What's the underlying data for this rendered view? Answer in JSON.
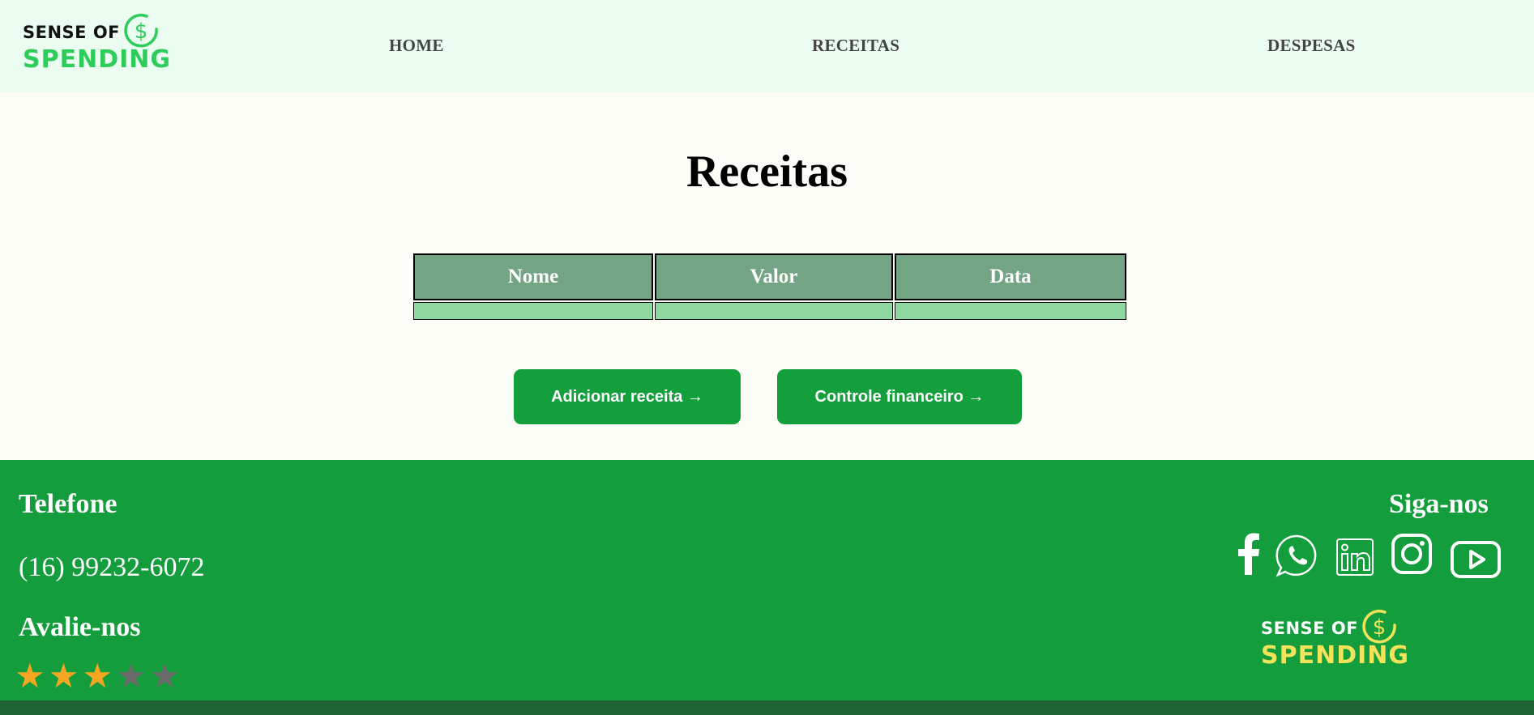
{
  "brand": {
    "line1": "SENSE OF",
    "line2": "SPENDING",
    "symbol": "$"
  },
  "nav": {
    "home": "HOME",
    "receitas": "RECEITAS",
    "despesas": "DESPESAS"
  },
  "main": {
    "title": "Receitas",
    "table": {
      "headers": [
        "Nome",
        "Valor",
        "Data"
      ],
      "rows": [
        [
          "",
          "",
          ""
        ]
      ]
    },
    "buttons": {
      "add": "Adicionar receita →",
      "control": "Controle financeiro →"
    }
  },
  "footer": {
    "phone_heading": "Telefone",
    "phone": "(16) 99232-6072",
    "rate_heading": "Avalie-nos",
    "rating": {
      "value": 3,
      "max": 5,
      "star_glyph": "★"
    },
    "follow_heading": "Siga-nos",
    "social_icons": [
      "facebook-icon",
      "whatsapp-icon",
      "linkedin-icon",
      "instagram-icon",
      "youtube-icon"
    ]
  },
  "colors": {
    "header_bg": "#eafdf0",
    "accent_green": "#13a03c",
    "logo_green": "#2ecc5a",
    "logo_yellow": "#f2e35a",
    "table_header": "#73a483",
    "table_row": "#90d8a0",
    "footer_bg": "#149d3c",
    "star_on": "#f5a623",
    "star_off": "#6b6b6b"
  }
}
